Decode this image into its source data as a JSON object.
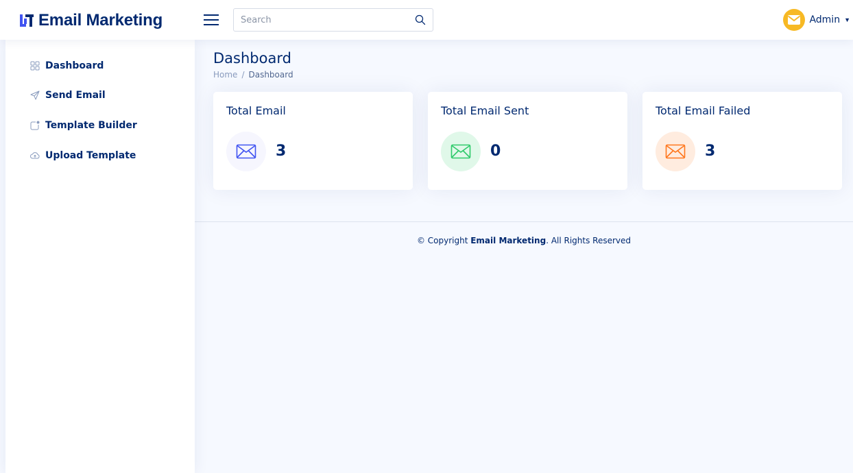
{
  "brand": {
    "name": "Email Marketing",
    "logo_icon": "logo-icon",
    "accent": "#4154f1"
  },
  "header": {
    "menu_icon": "hamburger-icon",
    "search": {
      "placeholder": "Search",
      "value": ""
    },
    "user": {
      "name": "Admin",
      "avatar_icon": "envelope-icon",
      "avatar_color": "#f7b924"
    }
  },
  "sidebar": {
    "items": [
      {
        "label": "Dashboard",
        "icon": "grid-icon"
      },
      {
        "label": "Send Email",
        "icon": "send-icon"
      },
      {
        "label": "Template Builder",
        "icon": "app-indicator-icon"
      },
      {
        "label": "Upload Template",
        "icon": "cloud-upload-icon"
      }
    ]
  },
  "main": {
    "title": "Dashboard",
    "breadcrumb": {
      "home": "Home",
      "separator": "/",
      "current": "Dashboard"
    },
    "cards": [
      {
        "title": "Total Email",
        "value": "3",
        "icon": "envelope-icon",
        "icon_color": "#4154f1",
        "icon_bg": "#f6f6fe"
      },
      {
        "title": "Total Email Sent",
        "value": "0",
        "icon": "envelope-icon",
        "icon_color": "#2eca6a",
        "icon_bg": "#e0f8e9"
      },
      {
        "title": "Total Email Failed",
        "value": "3",
        "icon": "envelope-icon",
        "icon_color": "#ff771d",
        "icon_bg": "#ffecdf"
      }
    ]
  },
  "footer": {
    "prefix": "© Copyright ",
    "brand": "Email Marketing",
    "suffix": ". All Rights Reserved"
  }
}
